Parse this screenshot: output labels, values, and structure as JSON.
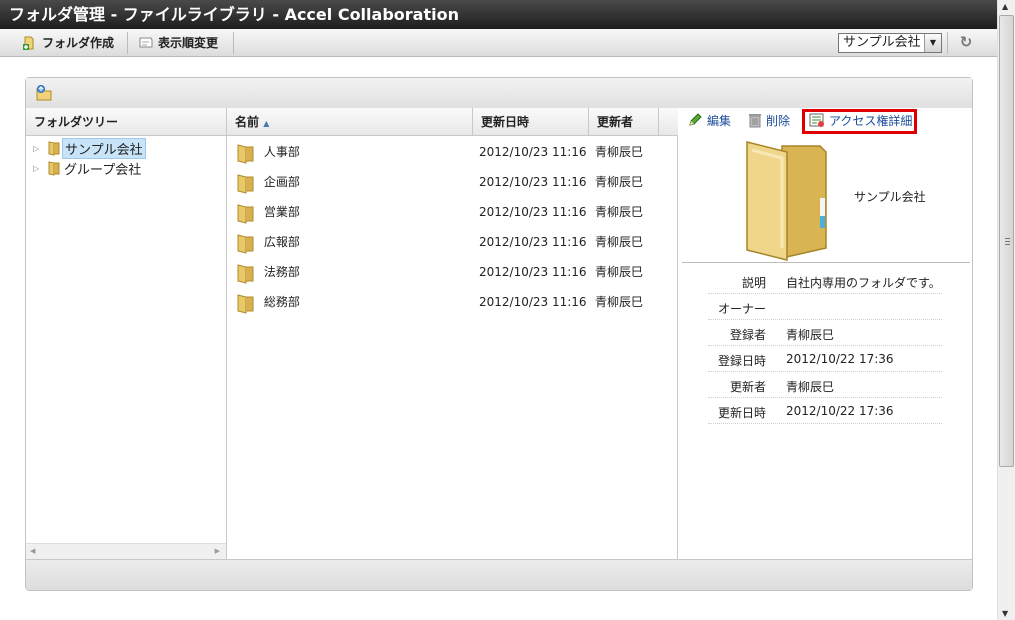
{
  "window": {
    "title": "フォルダ管理 - ファイルライブラリ - Accel Collaboration"
  },
  "toolbar": {
    "create_folder_label": "フォルダ作成",
    "change_order_label": "表示順変更",
    "company_select_value": "サンプル会社"
  },
  "tree": {
    "header": "フォルダツリー",
    "nodes": [
      {
        "label": "サンプル会社",
        "selected": true
      },
      {
        "label": "グループ会社",
        "selected": false
      }
    ]
  },
  "list": {
    "columns": {
      "name": "名前",
      "updated_at": "更新日時",
      "updated_by": "更新者"
    },
    "rows": [
      {
        "name": "人事部",
        "updated_at": "2012/10/23 11:16",
        "updated_by": "青柳辰巳"
      },
      {
        "name": "企画部",
        "updated_at": "2012/10/23 11:16",
        "updated_by": "青柳辰巳"
      },
      {
        "name": "営業部",
        "updated_at": "2012/10/23 11:16",
        "updated_by": "青柳辰巳"
      },
      {
        "name": "広報部",
        "updated_at": "2012/10/23 11:16",
        "updated_by": "青柳辰巳"
      },
      {
        "name": "法務部",
        "updated_at": "2012/10/23 11:16",
        "updated_by": "青柳辰巳"
      },
      {
        "name": "総務部",
        "updated_at": "2012/10/23 11:16",
        "updated_by": "青柳辰巳"
      }
    ]
  },
  "detail": {
    "actions": {
      "edit": "編集",
      "delete": "削除",
      "access_detail": "アクセス権詳細"
    },
    "folder_name": "サンプル会社",
    "properties": [
      {
        "label": "説明",
        "value": "自社内専用のフォルダです。"
      },
      {
        "label": "オーナー",
        "value": ""
      },
      {
        "label": "登録者",
        "value": "青柳辰巳"
      },
      {
        "label": "登録日時",
        "value": "2012/10/22 17:36"
      },
      {
        "label": "更新者",
        "value": "青柳辰巳"
      },
      {
        "label": "更新日時",
        "value": "2012/10/22 17:36"
      }
    ]
  },
  "icons": [
    "add-folder-icon",
    "order-icon",
    "refresh-icon",
    "folder-icon",
    "pencil-icon",
    "trash-icon",
    "access-icon",
    "sort-asc-icon",
    "expand-icon"
  ],
  "colors": {
    "title_bar": "#2b2b2b",
    "link": "#1a4c9a",
    "highlight": "#e00000",
    "folder": "#e9c86a",
    "selected": "#c8e4f8"
  }
}
